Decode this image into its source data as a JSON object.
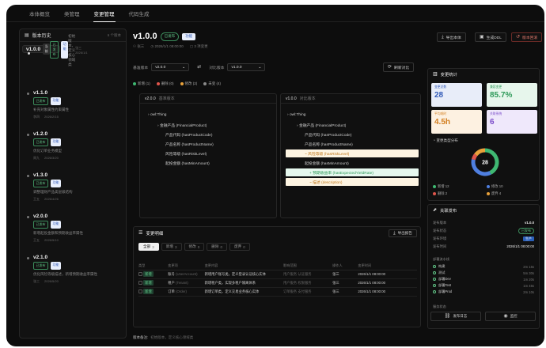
{
  "nav": {
    "tabs": [
      "本体概览",
      "类管理",
      "变更管理",
      "代码生成"
    ],
    "active_index": 2
  },
  "history": {
    "title": "版本历史",
    "count": "6 个版本",
    "versions": [
      {
        "name": "v1.0.0",
        "current_tag": "当前",
        "status": "已发布",
        "feature": "功能",
        "desc": "初始版本，定义核心领域类",
        "author": "张三",
        "date": "2026/1/1"
      },
      {
        "name": "v1.1.0",
        "status": "已发布",
        "feature": "功能",
        "desc": "补充对象属性约束属性",
        "author": "李四",
        "date": "2026/2/15"
      },
      {
        "name": "v1.2.0",
        "status": "已发布",
        "feature": "功能",
        "desc": "优化订单业务模型",
        "author": "周九",
        "date": "2026/3/20"
      },
      {
        "name": "v1.3.0",
        "status": "已发布",
        "feature": "功能",
        "desc": "调整理财产品类层级结构",
        "author": "王五",
        "date": "2026/4/26"
      },
      {
        "name": "v2.0.0",
        "status": "已发布",
        "feature": "功能",
        "desc": "新增起投金额和预期收益率属性",
        "author": "王五",
        "date": "2026/5/10"
      },
      {
        "name": "v2.1.0",
        "status": "已发布",
        "feature": "功能",
        "desc": "优化风险等级描述，新增预期收益率属性",
        "author": "张三",
        "date": "2026/5/20"
      }
    ]
  },
  "header": {
    "version": "v1.0.0",
    "status": "已发布",
    "feature": "功能",
    "author": "张三",
    "time": "2026/1/1 08:00:00",
    "changes": "3 项变更",
    "export_label": "导出本体",
    "ddl_label": "生成DDL",
    "rollback_label": "版本回滚"
  },
  "compare": {
    "base_label": "基准版本",
    "base_value": "v2.0.0",
    "target_label": "对比版本",
    "target_value": "v1.0.0",
    "refresh_label": "刷新对比",
    "legend": [
      {
        "label": "新增 (1)",
        "color": "#3fb872"
      },
      {
        "label": "删除 (0)",
        "color": "#e0564c"
      },
      {
        "label": "修改 (2)",
        "color": "#e9a23b"
      },
      {
        "label": "未变 (4)",
        "color": "#8a8a8a"
      }
    ]
  },
  "tree_left": {
    "version": "v2.0.0",
    "subtitle": "基准版本",
    "nodes": [
      "owl:Thing",
      "金融产品 (FinancialProduct)",
      "产品代码 (hasProductCode)",
      "产品名称 (hasProductName)",
      "风险等级 (hasRiskLevel)",
      "起投金额 (hasMinAmount)"
    ]
  },
  "tree_right": {
    "version": "v1.0.0",
    "subtitle": "对比版本",
    "nodes": [
      "owl:Thing",
      "金融产品 (FinancialProduct)",
      "产品代码 (hasProductCode)",
      "产品名称 (hasProductName)",
      "风险等级 (hasRiskLevel)",
      "起投金额 (hasMinAmount)",
      "预期收益率 (hasExpectedYieldRate)",
      "描述 (description)"
    ]
  },
  "detail": {
    "title": "变更明细",
    "export_label": "导出报告",
    "filters": [
      {
        "label": "全部",
        "n": "3"
      },
      {
        "label": "新增",
        "n": "3"
      },
      {
        "label": "修改",
        "n": "0"
      },
      {
        "label": "删除",
        "n": "0"
      },
      {
        "label": "废弃",
        "n": "0"
      }
    ],
    "columns": [
      "类型",
      "变更项",
      "变更内容",
      "影响范围",
      "操作人",
      "变更时间"
    ],
    "rows": [
      {
        "type": "新增",
        "item": "账号",
        "code": "(UserAccount)",
        "content": "新增用户账号类，定义登录认证核心实体",
        "scope": "用户服务",
        "scope2": "认证服务",
        "op": "张三",
        "time": "2026/1/1 08:00:00"
      },
      {
        "type": "新增",
        "item": "租户",
        "code": "(Tenant)",
        "content": "新增租户类，实现多租户隔离体系",
        "scope": "用户服务",
        "scope2": "权限服务",
        "op": "张三",
        "time": "2026/1/1 08:00:00"
      },
      {
        "type": "新增",
        "item": "订单",
        "code": "(Order)",
        "content": "新增订单类，定义交易业务核心实体",
        "scope": "订单服务",
        "scope2": "支付服务",
        "op": "张三",
        "time": "2026/1/1 08:00:00"
      }
    ]
  },
  "note": {
    "label": "版本备注:",
    "text": "初始版本，定义核心领域类"
  },
  "stats": {
    "title": "变更统计",
    "cards": [
      {
        "label": "变更总数",
        "value": "28",
        "bg": "#e8edf9",
        "fg": "#335bb8"
      },
      {
        "label": "兼容变更",
        "value": "85.7%",
        "bg": "#e7f6ec",
        "fg": "#2f9a5a"
      },
      {
        "label": "平均耗时",
        "value": "4.5h",
        "bg": "#fdf1e1",
        "fg": "#d27d1d"
      },
      {
        "label": "关联系统",
        "value": "6",
        "bg": "#efe8fb",
        "fg": "#7a4bc9"
      }
    ],
    "dist_title": "变更类型分布",
    "donut_total": "28",
    "dist": [
      {
        "label": "新增",
        "value": 12,
        "color": "#3fb872"
      },
      {
        "label": "修改",
        "value": 10,
        "color": "#4f7fe0"
      },
      {
        "label": "删除",
        "value": 2,
        "color": "#e0564c"
      },
      {
        "label": "废弃",
        "value": 4,
        "color": "#e9a23b"
      }
    ]
  },
  "release": {
    "title": "关联发布",
    "rows": [
      {
        "k": "发布版本",
        "v": "v1.0.0",
        "style": "bold"
      },
      {
        "k": "发布状态",
        "v": "已发布",
        "style": "green"
      },
      {
        "k": "发布环境",
        "v": "生产",
        "style": "blue"
      },
      {
        "k": "发布时间",
        "v": "2026/1/1 08:00:00",
        "style": "plain"
      }
    ],
    "steps_title": "部署流水线",
    "steps": [
      {
        "name": "构建",
        "dur": "2m 15s"
      },
      {
        "name": "测试",
        "dur": "5m 30s"
      },
      {
        "name": "部署Dev",
        "dur": "1m 20s"
      },
      {
        "name": "部署Test",
        "dur": "1m 45s"
      },
      {
        "name": "部署Prod",
        "dur": "2m 10s"
      }
    ],
    "service_title": "服务状态",
    "log_label": "发布日志",
    "monitor_label": "监控"
  }
}
